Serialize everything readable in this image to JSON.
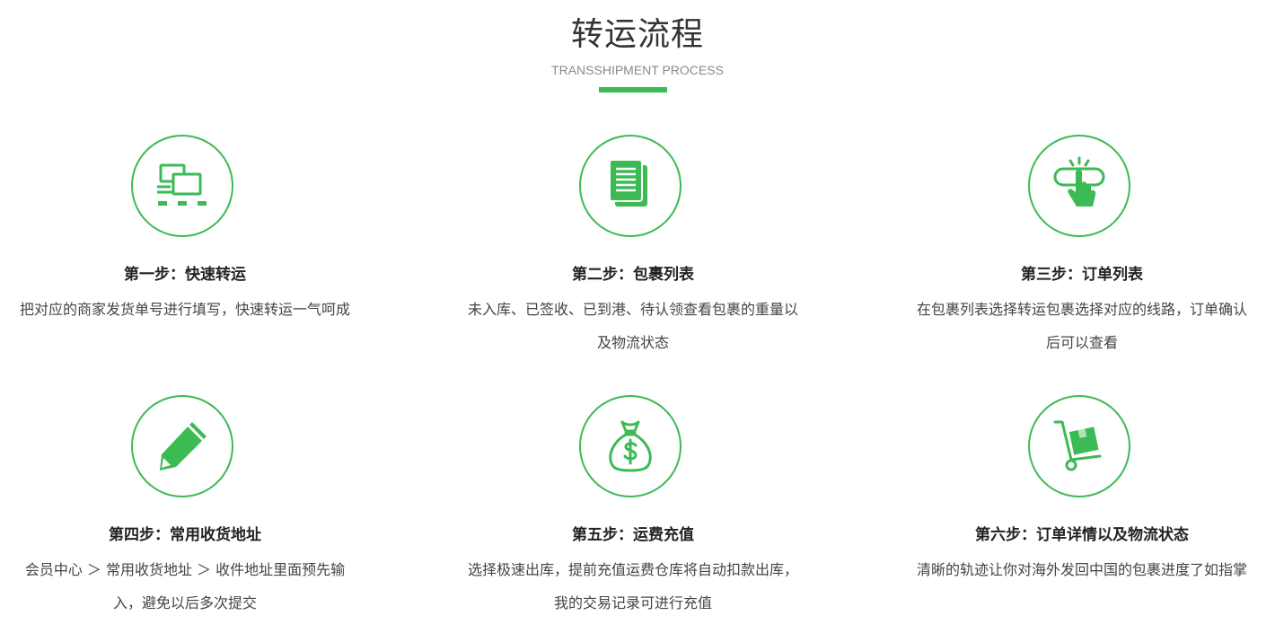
{
  "header": {
    "title": "转运流程",
    "subtitle": "TRANSSHIPMENT PROCESS"
  },
  "colors": {
    "accent": "#3cba54",
    "text": "#333333",
    "subtitle": "#8a8a8a"
  },
  "steps": [
    {
      "icon": "monitors-icon",
      "title": "第一步：快速转运",
      "desc": "把对应的商家发货单号进行填写，快速转运一气呵成"
    },
    {
      "icon": "documents-icon",
      "title": "第二步：包裹列表",
      "desc": "未入库、已签收、已到港、待认领查看包裹的重量以及物流状态"
    },
    {
      "icon": "hand-tap-icon",
      "title": "第三步：订单列表",
      "desc": "在包裹列表选择转运包裹选择对应的线路，订单确认后可以查看"
    },
    {
      "icon": "pencil-icon",
      "title": "第四步：常用收货地址",
      "desc": "会员中心 ＞ 常用收货地址 ＞ 收件地址里面预先输入，避免以后多次提交"
    },
    {
      "icon": "money-bag-icon",
      "title": "第五步：运费充值",
      "desc": "选择极速出库，提前充值运费仓库将自动扣款出库，我的交易记录可进行充值"
    },
    {
      "icon": "hand-truck-icon",
      "title": "第六步：订单详情以及物流状态",
      "desc": "清晰的轨迹让你对海外发回中国的包裹进度了如指掌"
    }
  ]
}
